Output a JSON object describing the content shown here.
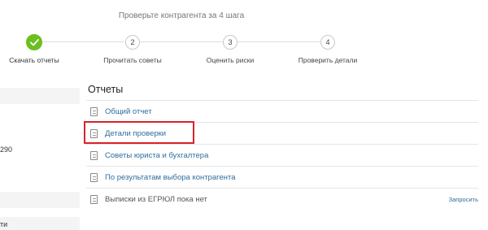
{
  "header": {
    "headline": "Проверьте контрагента за 4 шага"
  },
  "steps": [
    {
      "number": "",
      "label": "Скачать отчеты",
      "done": true
    },
    {
      "number": "2",
      "label": "Прочитать советы",
      "done": false
    },
    {
      "number": "3",
      "label": "Оценить риски",
      "done": false
    },
    {
      "number": "4",
      "label": "Проверить детали",
      "done": false
    }
  ],
  "left_panel": {
    "fragment_1": "290",
    "fragment_2": "ти"
  },
  "reports": {
    "title": "Отчеты",
    "items": [
      {
        "label": "Общий отчет",
        "link": true
      },
      {
        "label": "Детали проверки",
        "link": true
      },
      {
        "label": "Советы юриста и бухгалтера",
        "link": true
      },
      {
        "label": "По результатам выбора контрагента",
        "link": true
      },
      {
        "label": "Выписки из ЕГРЮЛ пока нет",
        "link": false,
        "action": "Запросить"
      }
    ]
  },
  "colors": {
    "done": "#6cbf1f",
    "link": "#2e6d9e",
    "highlight": "#d9232a"
  }
}
